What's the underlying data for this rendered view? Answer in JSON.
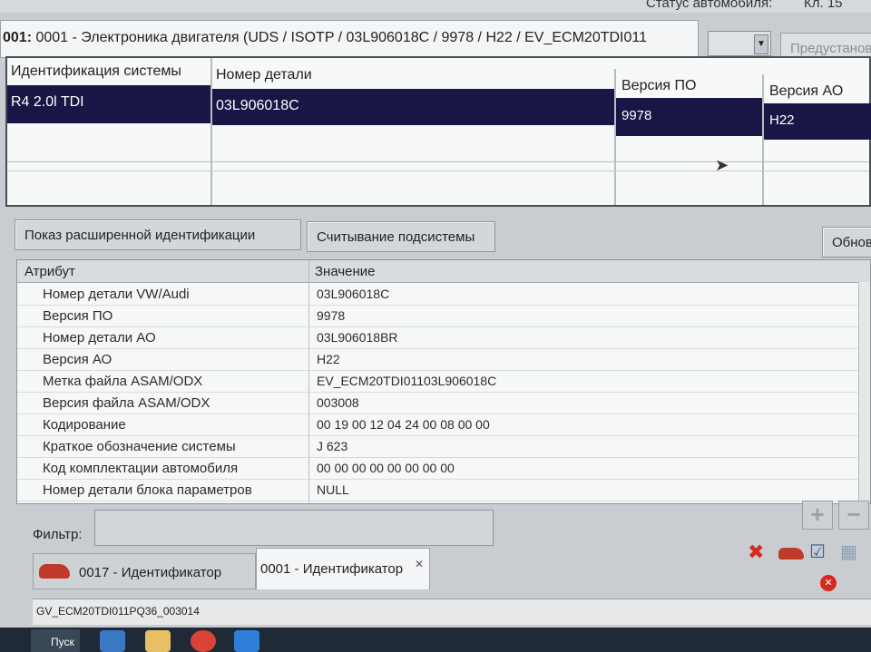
{
  "top": {
    "status_label": "Статус автомобиля:",
    "cl_label": "Кл. 15"
  },
  "window": {
    "title_bold": "001:",
    "title_rest": " 0001 - Электроника двигателя  (UDS / ISOTP / 03L906018C / 9978 / H22 / EV_ECM20TDI011",
    "preset_button": "Предустанов"
  },
  "ident": {
    "headers": [
      "Идентификация системы",
      "Номер детали",
      "Версия ПО",
      "Версия АО"
    ],
    "selected_row": [
      "R4 2.0l TDI",
      "03L906018C",
      "9978",
      "H22"
    ]
  },
  "buttons": {
    "extended": "Показ расширенной идентификации",
    "read_subsystem": "Считывание подсистемы",
    "refresh": "Обнов"
  },
  "attributes": {
    "headers": [
      "Атрибут",
      "Значение"
    ],
    "rows": [
      {
        "attr": "Номер детали VW/Audi",
        "value": "03L906018C"
      },
      {
        "attr": "Версия ПО",
        "value": "9978"
      },
      {
        "attr": "Номер детали АО",
        "value": "03L906018BR"
      },
      {
        "attr": "Версия АО",
        "value": "H22"
      },
      {
        "attr": "Метка файла ASAM/ODX",
        "value": "EV_ECM20TDI01103L906018C"
      },
      {
        "attr": "Версия файла ASAM/ODX",
        "value": "003008"
      },
      {
        "attr": "Кодирование",
        "value": "00 19 00 12 04 24 00 08 00 00"
      },
      {
        "attr": "Краткое обозначение системы",
        "value": "J 623"
      },
      {
        "attr": "Код комплектации автомобиля",
        "value": "00 00 00 00 00 00 00 00"
      },
      {
        "attr": "Номер детали блока параметров",
        "value": "NULL"
      }
    ]
  },
  "filter": {
    "label": "Фильтр:",
    "value": ""
  },
  "tabs": [
    {
      "label": "0017 - Идентификатор",
      "active": false
    },
    {
      "label": "0001 - Идентификатор",
      "active": true
    }
  ],
  "statusbar": {
    "text": "GV_ECM20TDI011PQ36_003014"
  },
  "taskbar": {
    "start": "Пуск"
  },
  "colors": {
    "selection": "#171644",
    "background": "#c9ccd0"
  }
}
